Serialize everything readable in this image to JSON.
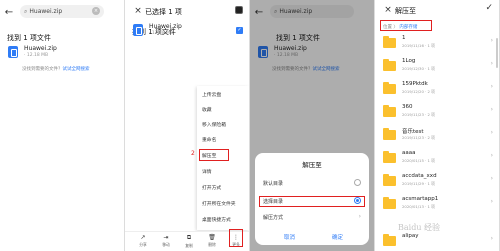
{
  "panel1": {
    "search_text": "Huawei.zip",
    "found_text": "找到 1 项文件",
    "file_name": "Huawei.zip",
    "file_meta": "· 12.18 MB",
    "hint_prefix": "没找到需要的文件？",
    "hint_link": "试试全网搜索"
  },
  "panel2": {
    "title": "已选择 1 项",
    "found_text": "找到 1 项文件",
    "file_name": "Huawei.zip",
    "file_meta": "· 12.18 MB",
    "menu": [
      "上传云盘",
      "收藏",
      "移入保险箱",
      "重命名",
      "解压至",
      "详情",
      "打开方式",
      "打开所在文件夹",
      "桌面快捷方式"
    ],
    "step_menu": "2",
    "step_more": "1",
    "bottom": [
      {
        "icon": "share-icon",
        "glyph": "↗",
        "label": "分享"
      },
      {
        "icon": "move-icon",
        "glyph": "⇥",
        "label": "移动"
      },
      {
        "icon": "copy-icon",
        "glyph": "⧉",
        "label": "复制"
      },
      {
        "icon": "delete-icon",
        "glyph": "🗑",
        "label": "删除"
      },
      {
        "icon": "more-icon",
        "glyph": "⋮",
        "label": "更多"
      }
    ]
  },
  "panel3": {
    "search_text": "Huawei.zip",
    "found_text": "找到 1 项文件",
    "file_name": "Huawei.zip",
    "file_meta": "· 12.18 MB",
    "hint_prefix": "没找到需要的文件？",
    "hint_link": "试试全网搜索",
    "sheet_title": "解压至",
    "options": [
      "默认目录",
      "选择目录",
      "解压方式"
    ],
    "cancel": "取消",
    "confirm": "确定"
  },
  "panel4": {
    "title": "解压至",
    "crumb_root": "位置 〉",
    "crumb_current": "内部存储",
    "folders": [
      {
        "name": "1",
        "date": "2019/11/16 · 1 项"
      },
      {
        "name": "1Log",
        "date": "2019/12/30 · 1 项"
      },
      {
        "name": "159Pktdk",
        "date": "2019/12/20 · 2 项"
      },
      {
        "name": "360",
        "date": "2019/11/23 · 2 项"
      },
      {
        "name": "音乐test",
        "date": "2019/11/23 · 2 项"
      },
      {
        "name": "aaaa",
        "date": "2020/01/15 · 1 项"
      },
      {
        "name": "accdata_xxd",
        "date": "2019/11/29 · 1 项"
      },
      {
        "name": "acsmartapp1",
        "date": "2020/01/13 · 1 项"
      },
      {
        "name": "alipay",
        "date": ""
      }
    ]
  },
  "watermark": "Baidu 经验"
}
